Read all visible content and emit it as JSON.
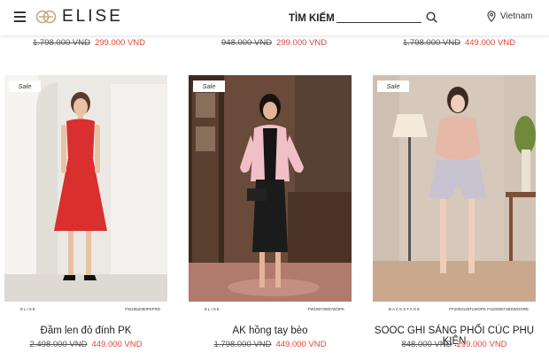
{
  "header": {
    "logo_text": "ELISE",
    "search_label": "TÌM KIẾM",
    "search_value": "",
    "location": "Vietnam"
  },
  "top_prices": [
    {
      "old": "1.798.000 VND",
      "new": "299.000 VND"
    },
    {
      "old": "948.000 VND",
      "new": "299.000 VND"
    },
    {
      "old": "1.798.000 VND",
      "new": "449.000 VND"
    }
  ],
  "products": [
    {
      "badge": "Sale",
      "caption_left": "ELISE",
      "caption_right": "FW1952050PKFRD",
      "name": "Đầm len đỏ đính PK",
      "old_price": "2.498.000 VND",
      "new_price": "449.000 VND"
    },
    {
      "badge": "Sale",
      "caption_left": "ELISE",
      "caption_right": "FW1907290CWOPK",
      "name": "AK hồng tay bèo",
      "old_price": "1.798.000 VND",
      "new_price": "449.000 VND"
    },
    {
      "badge": "Sale",
      "caption_left": "BACKSTAGE",
      "caption_right": "FF2002125TLWOPK   FS2005072BSWOGRE",
      "name": "SOOC GHI SÁNG PHỐI CÚC PHỤ KIỆN",
      "old_price": "848.000 VND",
      "new_price": "299.000 VND"
    }
  ],
  "colors": {
    "accent": "#e0453a",
    "dress_red": "#d92f2f",
    "jacket_pink": "#f1c0c6",
    "logo_gold": "#c8a77a"
  }
}
